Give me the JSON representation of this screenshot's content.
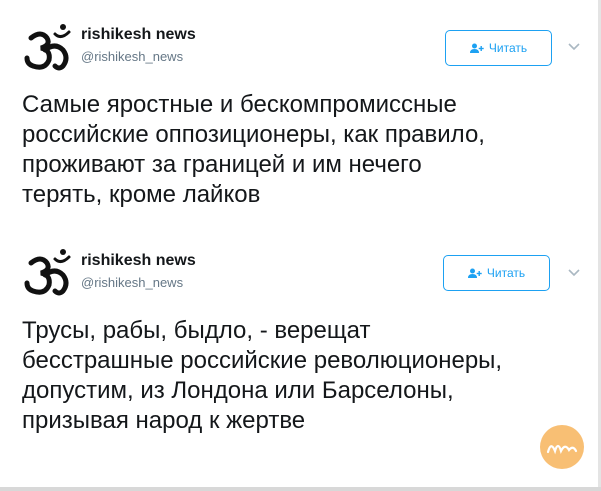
{
  "colors": {
    "accent": "#1da1f2",
    "text": "#14171a",
    "muted": "#657786",
    "watermark": "#f6a43a"
  },
  "tweets": [
    {
      "author_name": "rishikesh news",
      "author_handle": "@rishikesh_news",
      "avatar_icon": "om-symbol-icon",
      "follow_label": "Читать",
      "text_lines": [
        "Самые яростные и бескомпромиссные",
        "российские оппозиционеры, как правило,",
        "проживают за границей и им нечего",
        "терять, кроме лайков"
      ]
    },
    {
      "author_name": "rishikesh news",
      "author_handle": "@rishikesh_news",
      "avatar_icon": "om-symbol-icon",
      "follow_label": "Читать",
      "text_lines": [
        "Трусы, рабы, быдло, - верещат",
        "бесстрашные российские революционеры,",
        "допустим, из Лондона или Барселоны,",
        "призывая народ к жертве"
      ]
    }
  ]
}
